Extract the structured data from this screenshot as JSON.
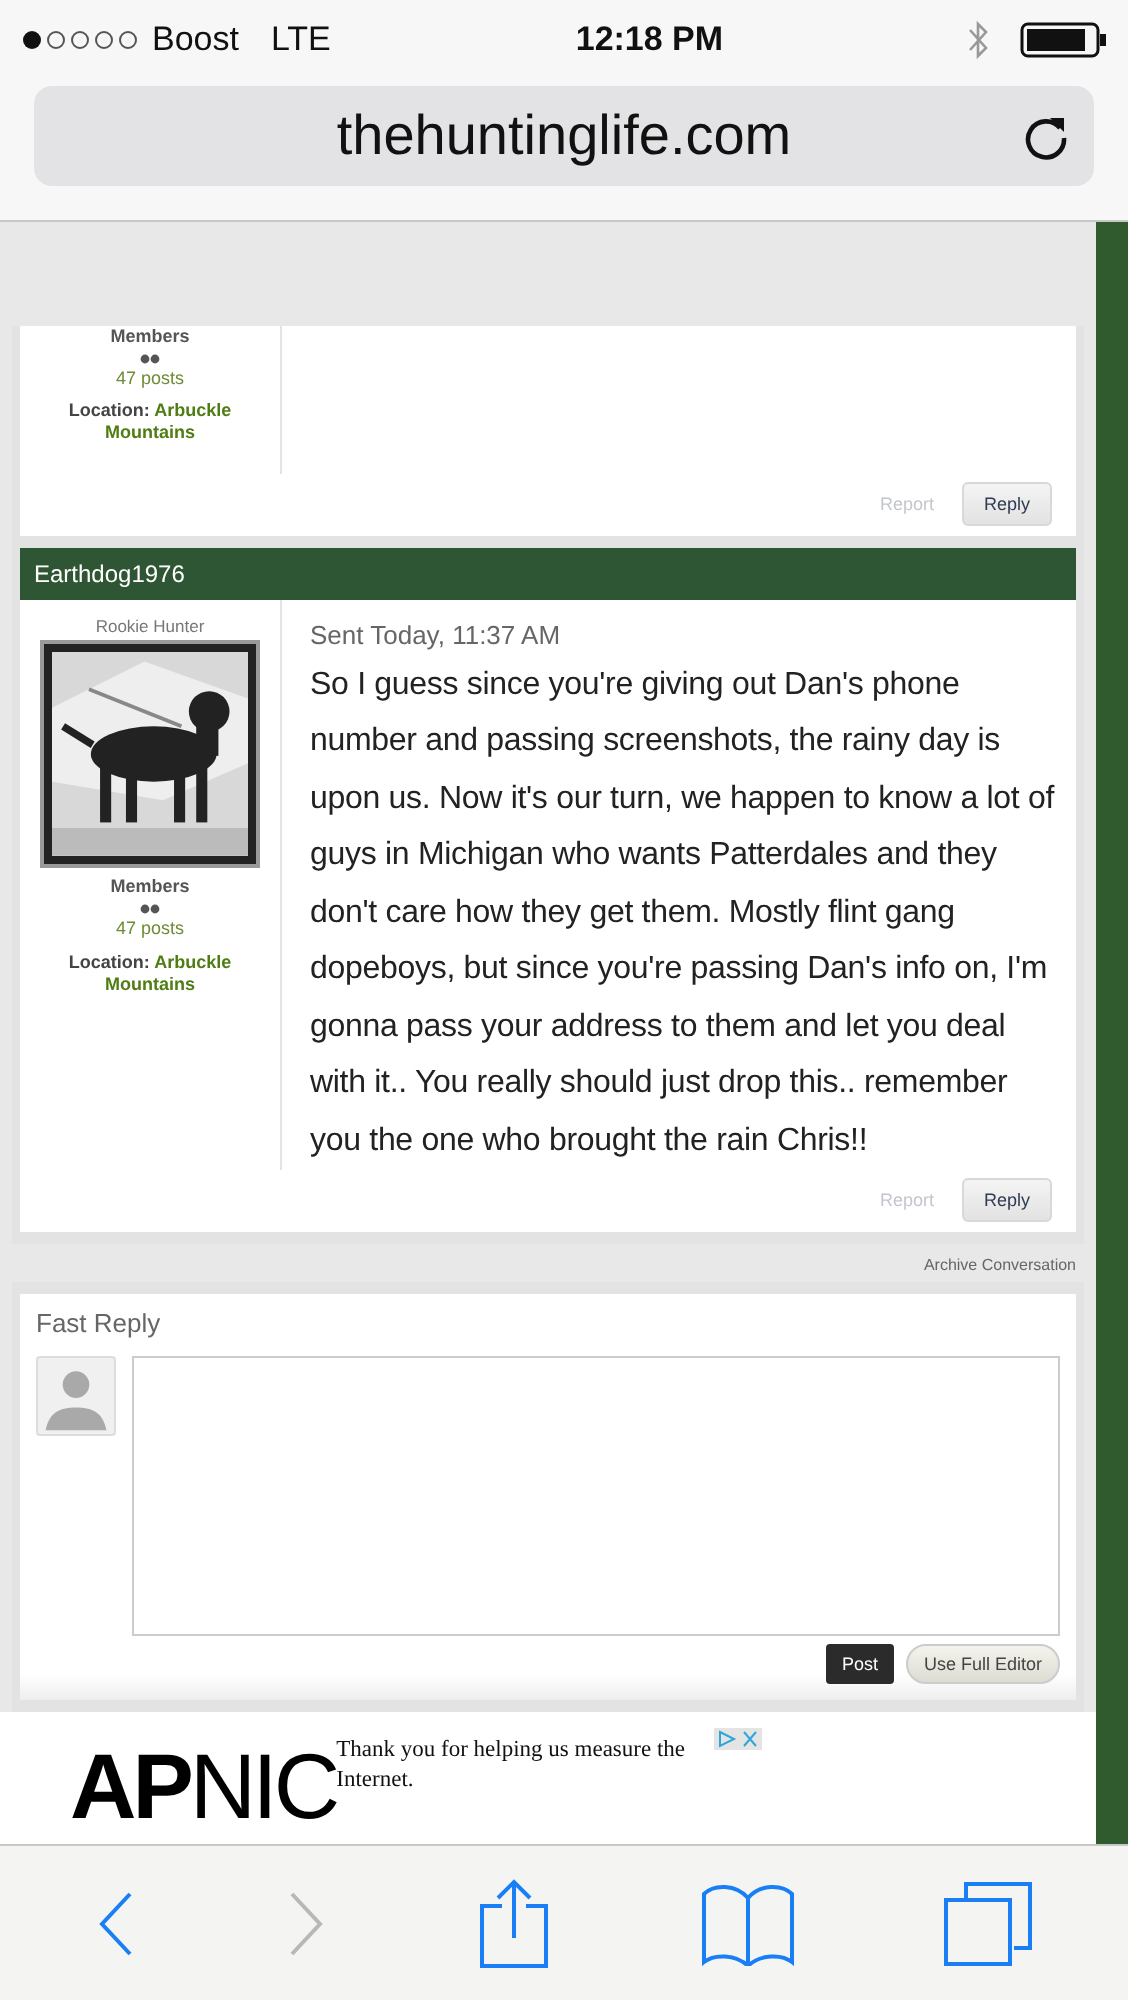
{
  "status_bar": {
    "carrier": "Boost",
    "network": "LTE",
    "time": "12:18 PM"
  },
  "address_bar": {
    "url": "thehuntinglife.com"
  },
  "previous_post": {
    "user_group": "Members",
    "posts": "47 posts",
    "location_label": "Location:",
    "location_value": "Arbuckle Mountains",
    "actions": [
      {
        "label": "Report",
        "disabled": true
      },
      {
        "label": "Reply",
        "disabled": false
      }
    ]
  },
  "post": {
    "author": "Earthdog1976",
    "rank": "Rookie Hunter",
    "user_group": "Members",
    "posts": "47 posts",
    "location_label": "Location:",
    "location_value": "Arbuckle Mountains",
    "sent": "Sent Today, 11:37 AM",
    "message": "So I guess since you're giving out Dan's phone number and passing screenshots, the rainy day is upon us. Now it's our turn, we happen to know a lot of guys in Michigan who wants Patterdales and they don't care how they get them. Mostly flint gang dopeboys, but since you're passing Dan's info on, I'm gonna pass your address to them and let you deal with it.. You really should just drop this.. remember you the one who brought the rain Chris!!",
    "actions": [
      {
        "label": "Report",
        "disabled": true
      },
      {
        "label": "Reply",
        "disabled": false
      }
    ]
  },
  "archive_link": "Archive Conversation",
  "fast_reply": {
    "title": "Fast Reply",
    "buttons": [
      {
        "label": "Post",
        "kind": "primary"
      },
      {
        "label": "Use Full Editor",
        "kind": "secondary"
      }
    ]
  },
  "ad": {
    "brand_bold": "AP",
    "brand_light": "NIC",
    "text": "Thank you for helping us measure the Internet."
  },
  "toolbar": [
    {
      "kind": "back",
      "disabled": false
    },
    {
      "kind": "forward",
      "disabled": true
    },
    {
      "kind": "share",
      "disabled": false
    },
    {
      "kind": "bookmarks",
      "disabled": false
    },
    {
      "kind": "tabs",
      "disabled": false
    }
  ]
}
